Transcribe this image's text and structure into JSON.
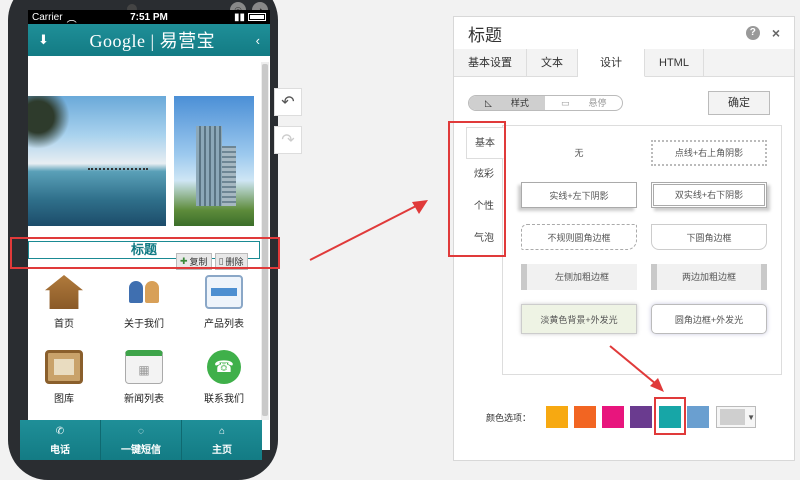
{
  "phone": {
    "status": {
      "carrier": "Carrier",
      "time": "7:51 PM"
    },
    "header": {
      "logo": "Google | 易营宝",
      "left_icon": "down-arrow-icon",
      "right_icon": "chevron-left-icon"
    },
    "title_module": {
      "title": "标题",
      "copy_label": "复制",
      "delete_label": "删除"
    },
    "grid": [
      {
        "label": "首页",
        "icon": "home-icon"
      },
      {
        "label": "关于我们",
        "icon": "people-icon"
      },
      {
        "label": "产品列表",
        "icon": "product-icon"
      },
      {
        "label": "图库",
        "icon": "gallery-icon"
      },
      {
        "label": "新闻列表",
        "icon": "calendar-icon"
      },
      {
        "label": "联系我们",
        "icon": "phone-icon"
      }
    ],
    "bottom_nav": [
      {
        "label": "电话",
        "icon": "phone-icon"
      },
      {
        "label": "一键短信",
        "icon": "sms-icon"
      },
      {
        "label": "主页",
        "icon": "home-icon"
      }
    ]
  },
  "dialog": {
    "title": "标题",
    "tabs": [
      "基本设置",
      "文本",
      "设计",
      "HTML"
    ],
    "active_tab": "设计",
    "toggle": {
      "style_label": "样式",
      "hover_label": "悬停"
    },
    "confirm_label": "确定",
    "style_tabs": [
      "基本",
      "炫彩",
      "个性",
      "气泡"
    ],
    "options": [
      "无",
      "点线+右上角阴影",
      "实线+左下阴影",
      "双实线+右下阴影",
      "不规则圆角边框",
      "下圆角边框",
      "左侧加粗边框",
      "两边加粗边框",
      "淡黄色背景+外发光",
      "圆角边框+外发光"
    ],
    "color_label": "颜色选项：",
    "colors": [
      "#f7a911",
      "#f26522",
      "#e8157d",
      "#6a3b8f",
      "#17a6a7",
      "#6a9fd0"
    ]
  }
}
